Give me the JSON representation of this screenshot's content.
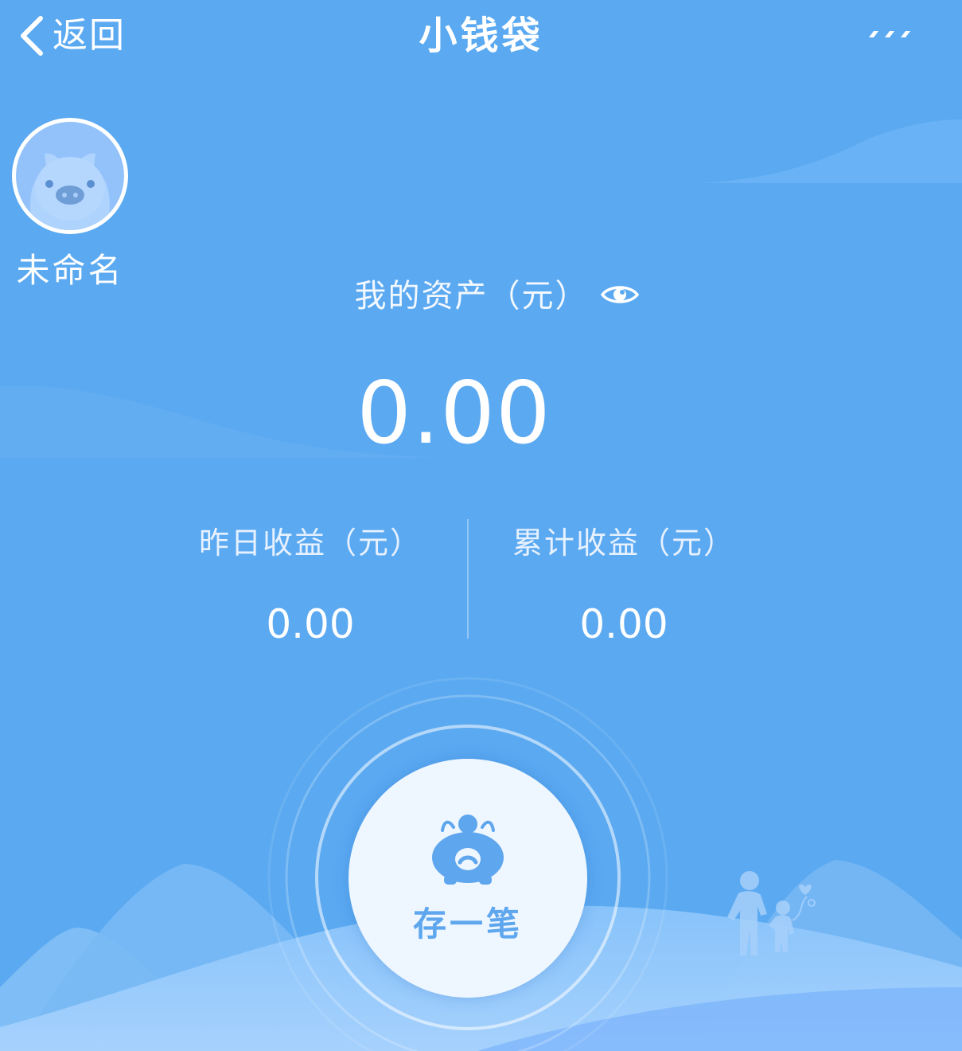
{
  "nav": {
    "back_label": "返回",
    "title": "小钱袋",
    "back_icon": "chevron-left-icon",
    "more_icon": "more-dots-icon"
  },
  "profile": {
    "avatar_icon": "pig-face-icon",
    "name": "未命名"
  },
  "assets": {
    "label": "我的资产（元）",
    "visibility_icon": "eye-icon",
    "value": "0.00"
  },
  "earnings": {
    "yesterday_label": "昨日收益（元）",
    "yesterday_value": "0.00",
    "total_label": "累计收益（元）",
    "total_value": "0.00"
  },
  "deposit": {
    "icon": "piggy-bank-icon",
    "label": "存一笔"
  },
  "colors": {
    "background": "#5aa9f1",
    "button_text": "#5ea6ee",
    "button_bg": "#eef6ff"
  }
}
